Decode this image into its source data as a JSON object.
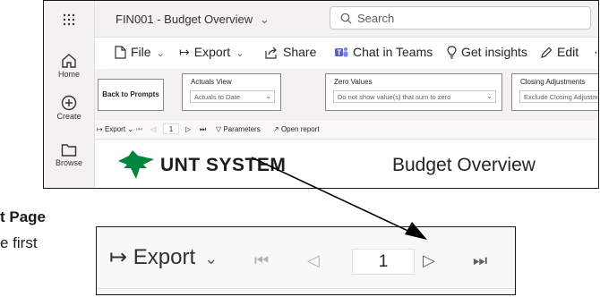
{
  "rail": {
    "items": [
      {
        "label": "Home",
        "icon": "home-icon"
      },
      {
        "label": "Create",
        "icon": "plus-circle-icon"
      },
      {
        "label": "Browse",
        "icon": "folder-icon"
      }
    ]
  },
  "header": {
    "waffle_icon": "app-launcher-icon",
    "title": "FIN001 - Budget Overview",
    "title_chevron": "⌄",
    "search_placeholder": "Search"
  },
  "toolbar": {
    "file_label": "File",
    "export_label": "Export",
    "share_label": "Share",
    "teams_label": "Chat in Teams",
    "insights_label": "Get insights",
    "edit_label": "Edit",
    "more_label": "⋯"
  },
  "params": {
    "back_button": "Back to Prompts",
    "cards": [
      {
        "label": "Actuals View",
        "value": "Actuals to Date"
      },
      {
        "label": "Zero Values",
        "value": "Do not show value(s) that sum to zero"
      },
      {
        "label": "Closing Adjustments",
        "value": "Exclude Closing Adjustme..."
      }
    ]
  },
  "report_toolbar": {
    "export_label": "Export",
    "page_number": "1",
    "parameters_label": "Parameters",
    "open_report_label": "Open report"
  },
  "report": {
    "logo_text": "UNT SYSTEM",
    "title": "Budget Overview"
  },
  "zoom": {
    "export_label": "Export",
    "page_number": "1"
  },
  "document": {
    "bold_fragment": "t Page",
    "text_fragment": "e first"
  },
  "colors": {
    "logo_green": "#00853e",
    "rail_bg": "#f3f2f1"
  }
}
